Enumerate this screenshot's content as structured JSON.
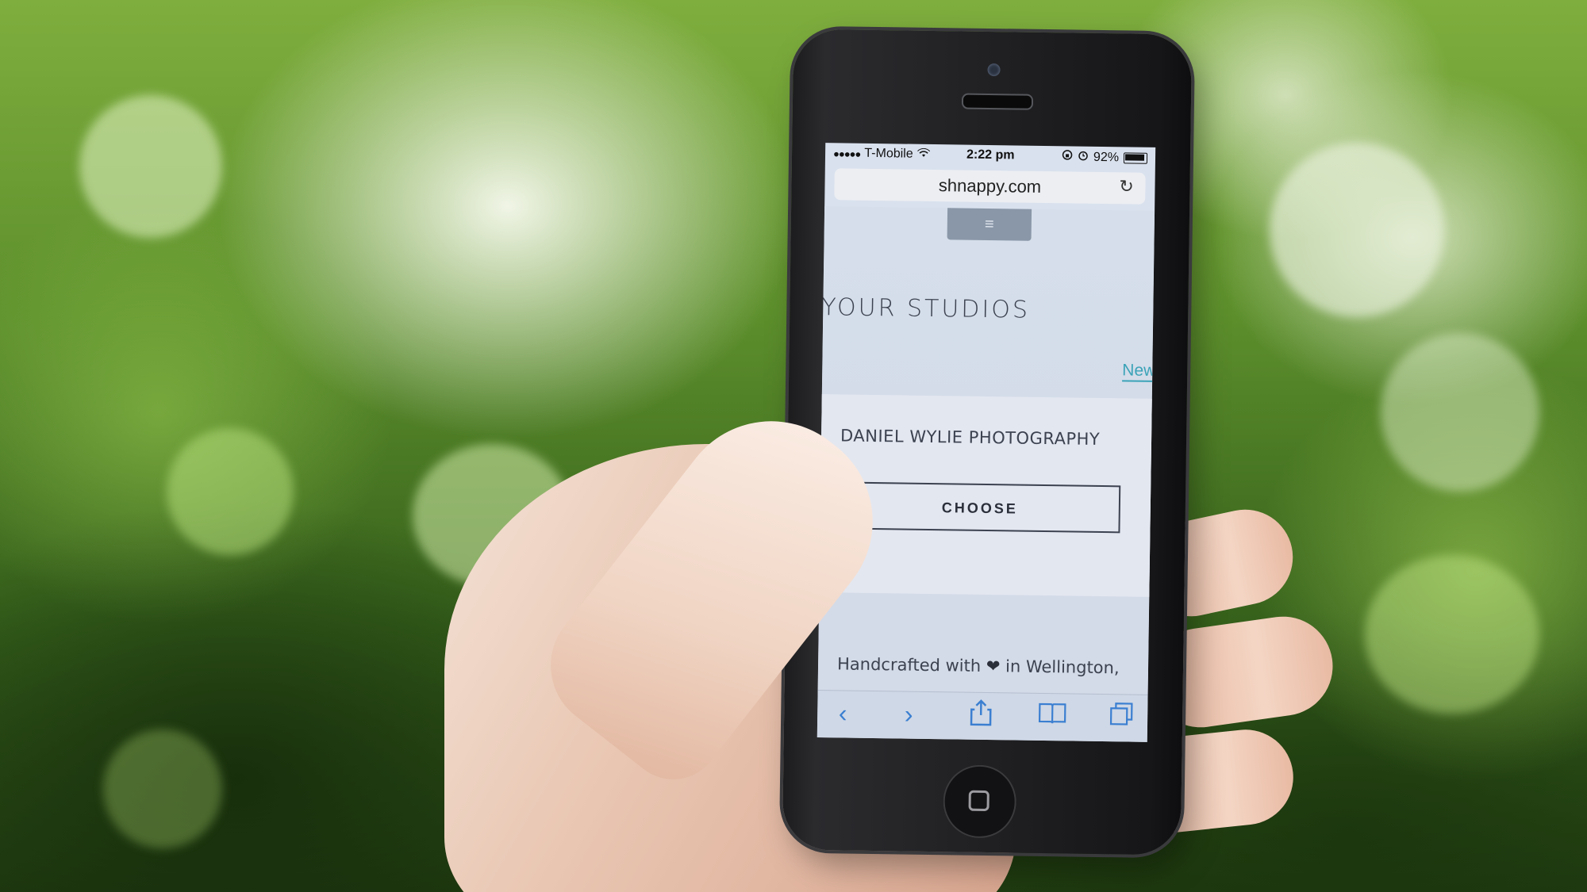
{
  "status_bar": {
    "signal": "●●●●●",
    "carrier": "T-Mobile",
    "wifi_icon": "wifi-icon",
    "time": "2:22 pm",
    "battery_percent": "92%"
  },
  "browser": {
    "url": "shnappy.com",
    "reload_icon": "reload-icon"
  },
  "page": {
    "menu_icon": "≡",
    "title": "YOUR STUDIOS",
    "new_link": "New",
    "studio_name": "DANIEL WYLIE PHOTOGRAPHY",
    "choose_label": "CHOOSE",
    "footer_prefix": "Handcrafted with",
    "footer_heart": "❤",
    "footer_suffix": "in Wellington,"
  },
  "toolbar": {
    "back": "‹",
    "forward": "›",
    "share": "⇪",
    "bookmarks": "📖",
    "tabs": "⧉"
  },
  "colors": {
    "link": "#3ba3b8",
    "toolbar_icon": "#3b7fd1"
  }
}
